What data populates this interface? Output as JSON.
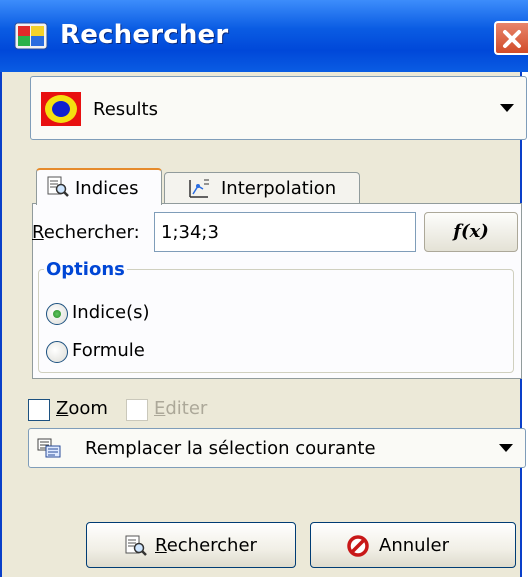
{
  "window": {
    "title": "Rechercher"
  },
  "source_combo": {
    "value": "Results"
  },
  "tabs": [
    {
      "label": "Indices",
      "selected": true
    },
    {
      "label": "Interpolation",
      "selected": false
    }
  ],
  "search": {
    "label_u": "R",
    "label_rest": "echercher:",
    "value": "1;34;3",
    "fx_label": "f(x)"
  },
  "options": {
    "legend": "Options",
    "items": [
      {
        "label": "Indice(s)",
        "checked": true
      },
      {
        "label": "Formule",
        "checked": false
      }
    ]
  },
  "checkboxes": {
    "zoom": {
      "label_u": "Z",
      "label_rest": "oom",
      "checked": false
    },
    "editer": {
      "label_u": "E",
      "label_rest": "diter",
      "checked": false,
      "disabled": true
    }
  },
  "mode_combo": {
    "value": "Remplacer la sélection courante"
  },
  "buttons": {
    "search": {
      "label_u": "R",
      "label_rest": "echercher"
    },
    "cancel": {
      "label": "Annuler"
    }
  },
  "colors": {
    "title_bar": "#0a5ce3",
    "legend": "#0046d5",
    "close": "#d14c2a"
  }
}
